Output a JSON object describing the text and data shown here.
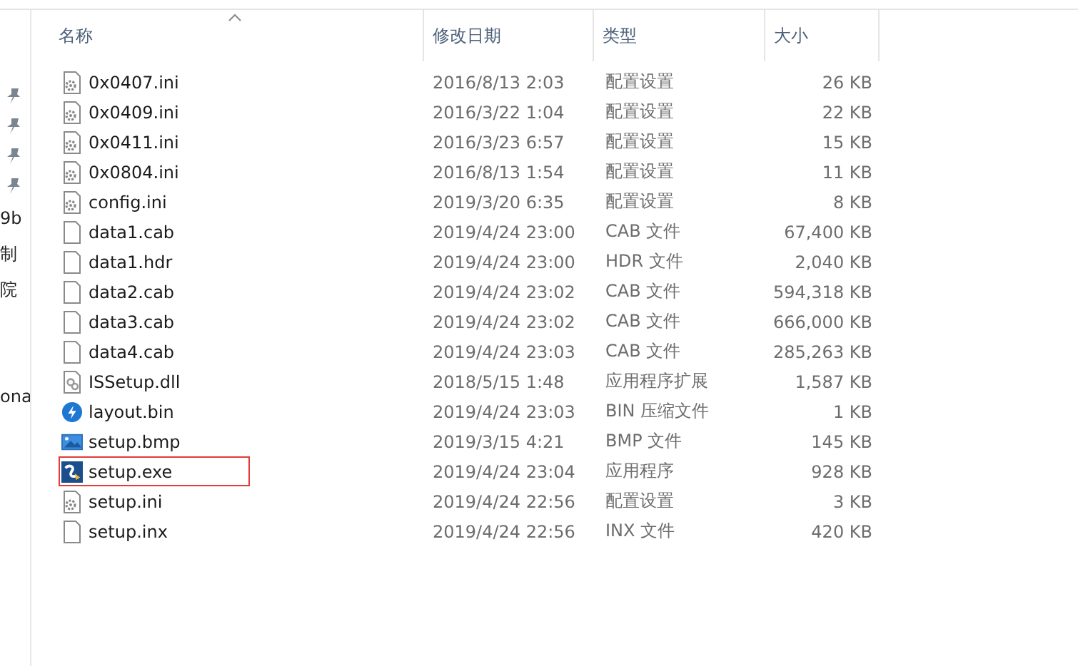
{
  "sidebar": {
    "pins": [
      {
        "kind": "pin"
      },
      {
        "kind": "pin"
      },
      {
        "kind": "pin"
      },
      {
        "kind": "pin"
      }
    ],
    "items": [
      {
        "label": "9b"
      },
      {
        "label": "制"
      },
      {
        "label": "院"
      },
      {
        "label": "ona"
      }
    ]
  },
  "table": {
    "columns": [
      {
        "label": "名称",
        "sorted": true
      },
      {
        "label": "修改日期",
        "sorted": false
      },
      {
        "label": "类型",
        "sorted": false
      },
      {
        "label": "大小",
        "sorted": false
      }
    ],
    "rows": [
      {
        "kind": "settings",
        "name": "0x0407.ini",
        "date": "2016/8/13 2:03",
        "type": "配置设置",
        "size": "26 KB",
        "highlighted": false
      },
      {
        "kind": "settings",
        "name": "0x0409.ini",
        "date": "2016/3/22 1:04",
        "type": "配置设置",
        "size": "22 KB",
        "highlighted": false
      },
      {
        "kind": "settings",
        "name": "0x0411.ini",
        "date": "2016/3/23 6:57",
        "type": "配置设置",
        "size": "15 KB",
        "highlighted": false
      },
      {
        "kind": "settings",
        "name": "0x0804.ini",
        "date": "2016/8/13 1:54",
        "type": "配置设置",
        "size": "11 KB",
        "highlighted": false
      },
      {
        "kind": "settings",
        "name": "config.ini",
        "date": "2019/3/20 6:35",
        "type": "配置设置",
        "size": "8 KB",
        "highlighted": false
      },
      {
        "kind": "blank",
        "name": "data1.cab",
        "date": "2019/4/24 23:00",
        "type": "CAB 文件",
        "size": "67,400 KB",
        "highlighted": false
      },
      {
        "kind": "blank",
        "name": "data1.hdr",
        "date": "2019/4/24 23:00",
        "type": "HDR 文件",
        "size": "2,040 KB",
        "highlighted": false
      },
      {
        "kind": "blank",
        "name": "data2.cab",
        "date": "2019/4/24 23:02",
        "type": "CAB 文件",
        "size": "594,318 KB",
        "highlighted": false
      },
      {
        "kind": "blank",
        "name": "data3.cab",
        "date": "2019/4/24 23:02",
        "type": "CAB 文件",
        "size": "666,000 KB",
        "highlighted": false
      },
      {
        "kind": "blank",
        "name": "data4.cab",
        "date": "2019/4/24 23:03",
        "type": "CAB 文件",
        "size": "285,263 KB",
        "highlighted": false
      },
      {
        "kind": "library",
        "name": "ISSetup.dll",
        "date": "2018/5/15 1:48",
        "type": "应用程序扩展",
        "size": "1,587 KB",
        "highlighted": false
      },
      {
        "kind": "archive",
        "name": "layout.bin",
        "date": "2019/4/24 23:03",
        "type": "BIN 压缩文件",
        "size": "1 KB",
        "highlighted": false
      },
      {
        "kind": "image",
        "name": "setup.bmp",
        "date": "2019/3/15 4:21",
        "type": "BMP 文件",
        "size": "145 KB",
        "highlighted": false
      },
      {
        "kind": "program",
        "name": "setup.exe",
        "date": "2019/4/24 23:04",
        "type": "应用程序",
        "size": "928 KB",
        "highlighted": true
      },
      {
        "kind": "settings",
        "name": "setup.ini",
        "date": "2019/4/24 22:56",
        "type": "配置设置",
        "size": "3 KB",
        "highlighted": false
      },
      {
        "kind": "blank",
        "name": "setup.inx",
        "date": "2019/4/24 22:56",
        "type": "INX 文件",
        "size": "420 KB",
        "highlighted": false
      }
    ]
  }
}
